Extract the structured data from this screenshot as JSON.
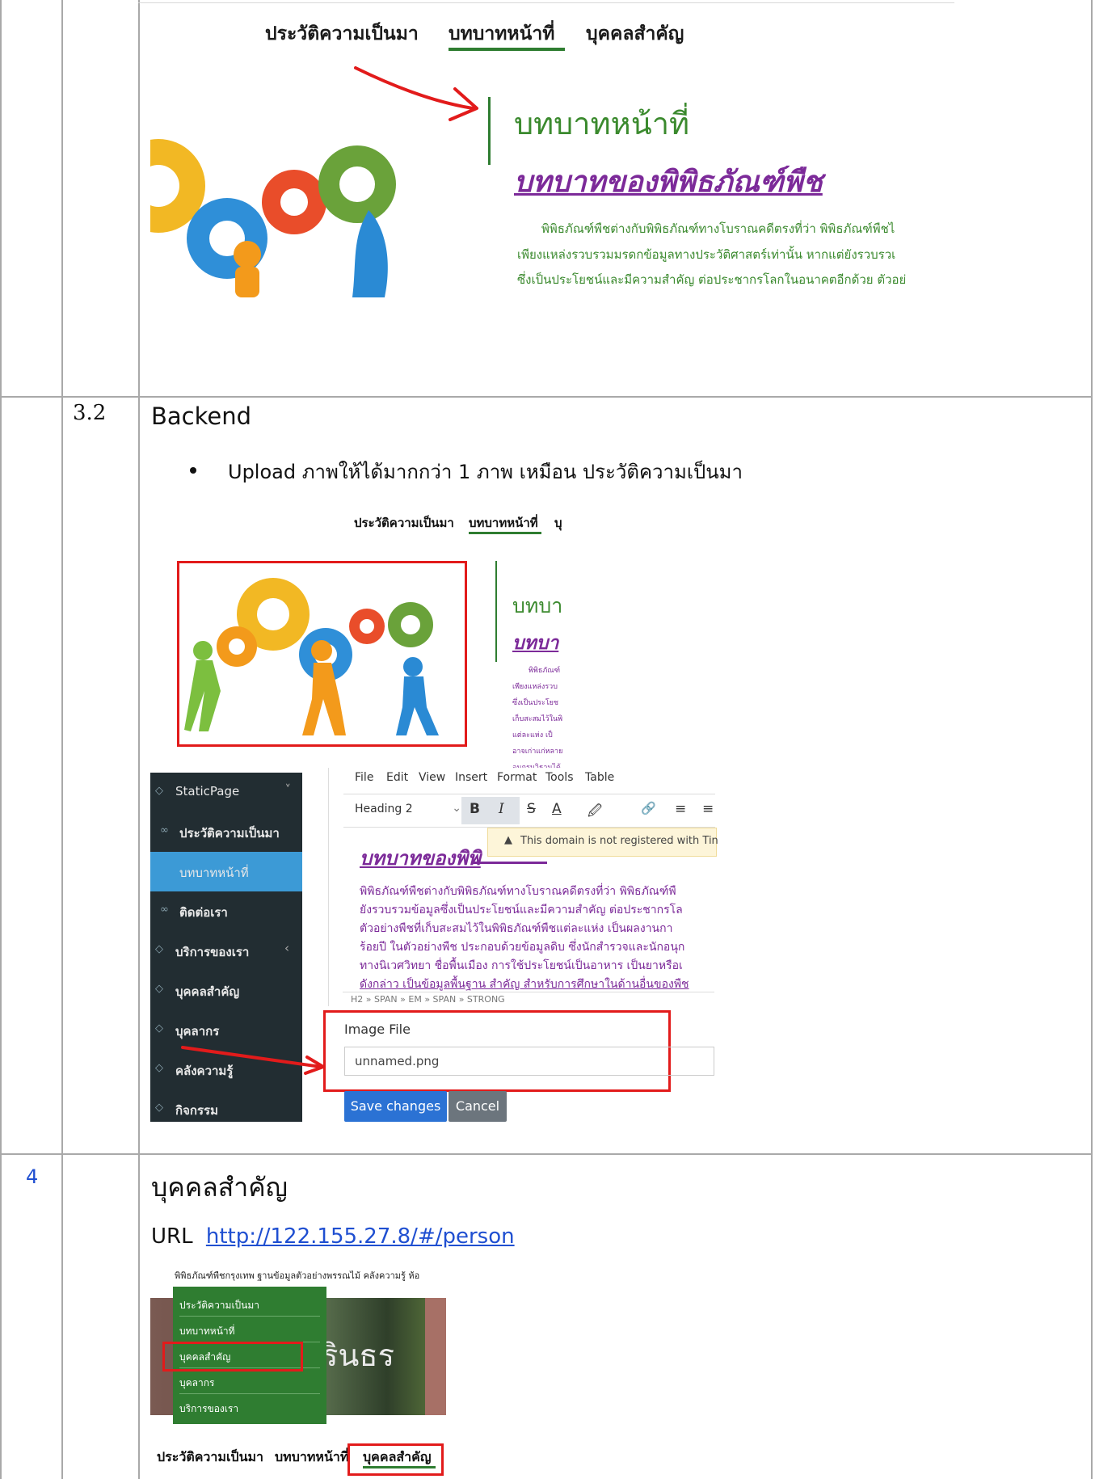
{
  "section3": {
    "tabs": [
      "ประวัติความเป็นมา",
      "บทบาทหน้าที่",
      "บุคคลสำคัญ"
    ],
    "heading": "บทบาทหน้าที่",
    "subheading": "บทบาทของพิพิธภัณฑ์พืช",
    "paragraph_lines": [
      "พิพิธภัณฑ์พืชต่างกับพิพิธภัณฑ์ทางโบราณคดีตรงที่ว่า   พิพิธภัณฑ์พืชไ",
      "เพียงแหล่งรวบรวมมรดกข้อมูลทางประวัติศาสตร์เท่านั้น   หากแต่ยังรวบรวเ",
      "ซึ่งเป็นประโยชน์และมีความสำคัญ   ต่อประชากรโลกในอนาคตอีกด้วย   ตัวอย่"
    ]
  },
  "section32": {
    "number": "3.2",
    "title": "Backend",
    "bullet": "Upload ภาพให้ได้มากกว่า 1 ภาพ เหมือน ประวัติความเป็นมา",
    "mini_tabs": [
      "ประวัติความเป็นมา",
      "บทบาทหน้าที่",
      "บุ"
    ],
    "mini_heading": "บทบา",
    "mini_subheading": "บทบา",
    "mini_lines": [
      "พิพิธภัณฑ์",
      "เพียงแหล่งรวบ",
      "ซึ่งเป็นประโยช",
      "เก็บสะสมไว้ในพิ",
      "แต่ละแห่ง   เป็",
      "อาจเก่าแก่หลาย",
      "อนุกรมวิธานได้"
    ],
    "editor": {
      "menu": [
        "File",
        "Edit",
        "View",
        "Insert",
        "Format",
        "Tools",
        "Table"
      ],
      "block_select": "Heading 2",
      "tools": [
        "B",
        "I",
        "S",
        "A",
        "🖉",
        "🔗",
        "≡",
        "≡"
      ],
      "warning": "This domain is not registered with Tin",
      "content_title": "บทบาทของพิพิ",
      "content_lines": [
        "พิพิธภัณฑ์พืชต่างกับพิพิธภัณฑ์ทางโบราณคดีตรงที่ว่า   พิพิธภัณฑ์พื",
        "ยังรวบรวมข้อมูลซึ่งเป็นประโยชน์และมีความสำคัญ     ต่อประชากรโล",
        "ตัวอย่างพืชที่เก็บสะสมไว้ในพิพิธภัณฑ์พืชแต่ละแห่ง    เป็นผลงานกา",
        "ร้อยปี ในตัวอย่างพืช ประกอบด้วยข้อมูลดิบ ซึ่งนักสำรวจและนักอนุก",
        "ทางนิเวศวิทยา ชื่อพื้นเมือง การใช้ประโยชน์เป็นอาหาร เป็นยาหรือเ",
        "ดังกล่าว เป็นข้อมูลพื้นฐาน สำคัญ สำหรับการศึกษาในด้านอื่นของพืช"
      ],
      "path": "H2 » SPAN » EM » SPAN » STRONG",
      "image_label": "Image File",
      "image_value": "unnamed.png",
      "save": "Save changes",
      "cancel": "Cancel"
    },
    "sidebar": [
      {
        "label": "StaticPage",
        "icon": "tag-icon",
        "suffix": "˅"
      },
      {
        "label": "ประวัติความเป็นมา",
        "icon": "link-icon",
        "suffix": ""
      },
      {
        "label": "บทบาทหน้าที่",
        "icon": "",
        "suffix": ""
      },
      {
        "label": "ติดต่อเรา",
        "icon": "link-icon",
        "suffix": ""
      },
      {
        "label": "บริการของเรา",
        "icon": "tag-icon",
        "suffix": "‹"
      },
      {
        "label": "บุคคลสำคัญ",
        "icon": "tag-icon",
        "suffix": ""
      },
      {
        "label": "บุคลากร",
        "icon": "tag-icon",
        "suffix": ""
      },
      {
        "label": "คลังความรู้",
        "icon": "tag-icon",
        "suffix": ""
      },
      {
        "label": "กิจกรรม",
        "icon": "tag-icon",
        "suffix": ""
      }
    ]
  },
  "section4": {
    "number": "4",
    "title": "บุคคลสำคัญ",
    "url_label": "URL",
    "url": "http://122.155.27.8/#/person",
    "navbar": "พิพิธภัณฑ์พืชกรุงเทพ  ฐานข้อมูลตัวอย่างพรรณไม้  คลังความรู้  ห้อ",
    "dropdown": [
      "ประวัติความเป็นมา",
      "บทบาทหน้าที่",
      "บุคคลสำคัญ",
      "บุคลากร",
      "บริการของเรา"
    ],
    "sign_text": "ิรินธร",
    "bottom_tabs": [
      "ประวัติความเป็นมา",
      "บทบาทหน้าที่",
      "บุคคลสำคัญ"
    ]
  },
  "colors": {
    "accent_green": "#2f7d31",
    "heading_purple": "#7c2a99",
    "red_annotation": "#e21b1b",
    "sidebar": "#222d32",
    "sidebar_active": "#3c9ad6"
  }
}
